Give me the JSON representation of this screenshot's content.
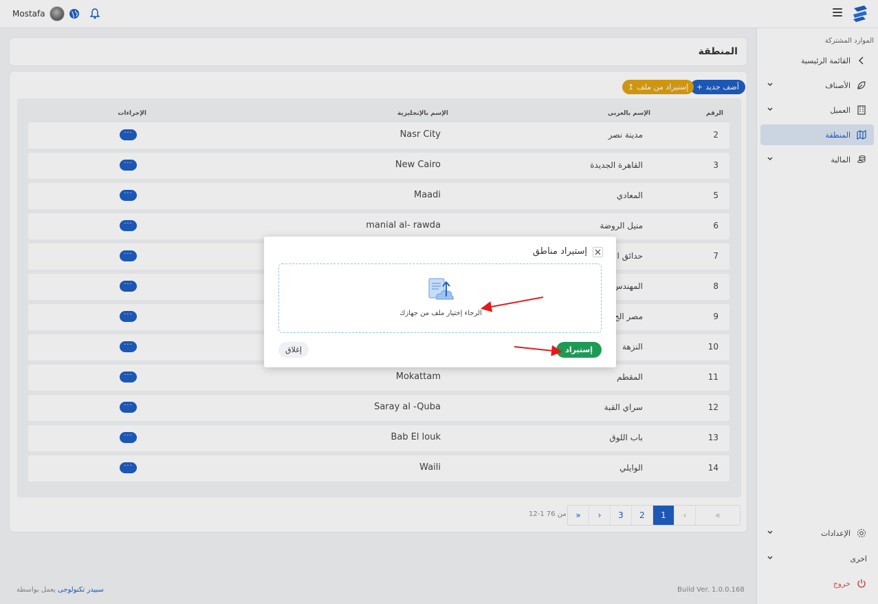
{
  "topbar": {
    "user_name": "Mostafa"
  },
  "sidebar": {
    "section_title": "الموارد المشتركة",
    "items": [
      {
        "label": "القائمة الرئيسية"
      },
      {
        "label": "الأصناف"
      },
      {
        "label": "العميل"
      },
      {
        "label": "المنطقة"
      },
      {
        "label": "المالية"
      }
    ],
    "settings_label": "الإعدادات",
    "other_label": "اخرى",
    "logout_label": "خروج"
  },
  "page": {
    "title": "المنطقة",
    "add_button": "أضف جديد",
    "import_file_button": "إستيراد من ملف"
  },
  "table": {
    "headers": {
      "num": "الرقم",
      "name_ar": "الإسم بالعربى",
      "name_en": "الإسم بالإنجليزية",
      "actions": "الإجراءات"
    },
    "rows": [
      {
        "num": "2",
        "ar": "مدينة نصر",
        "en": "Nasr City"
      },
      {
        "num": "3",
        "ar": "القاهرة الجديدة",
        "en": "New Cairo"
      },
      {
        "num": "5",
        "ar": "المعادي",
        "en": "Maadi"
      },
      {
        "num": "6",
        "ar": "منيل الروضة",
        "en": "manial al- rawda"
      },
      {
        "num": "7",
        "ar": "حدائق ا",
        "en": ""
      },
      {
        "num": "8",
        "ar": "المهندس",
        "en": ""
      },
      {
        "num": "9",
        "ar": "مصر الج",
        "en": ""
      },
      {
        "num": "10",
        "ar": "النزهة",
        "en": ""
      },
      {
        "num": "11",
        "ar": "المقطم",
        "en": "Mokattam"
      },
      {
        "num": "12",
        "ar": "سراي القبة",
        "en": "Saray al -Quba"
      },
      {
        "num": "13",
        "ar": "باب اللوق",
        "en": "Bab El louk"
      },
      {
        "num": "14",
        "ar": "الوايلي",
        "en": "Waili"
      }
    ],
    "action_label": "···"
  },
  "pagination": {
    "first": "«",
    "prev": "‹",
    "pages": [
      "1",
      "2",
      "3"
    ],
    "next": "›",
    "last": "»",
    "info": "12-1 من 76"
  },
  "footer": {
    "powered_prefix": "يعمل بواسطة",
    "powered_link": "سبيدر تكنولوجى",
    "build": "Build Ver. 1.0.0.168"
  },
  "modal": {
    "title": "إستيراد مناطق",
    "dropzone_text": "الرجاء إختيار ملف من جهازك",
    "import_button": "إستيراد",
    "close_button": "إغلاق"
  },
  "colors": {
    "primary": "#1f5fc4",
    "warning": "#e0a312",
    "success": "#1d9a56",
    "danger": "#d9534f",
    "annotation_arrow": "#e21b1b"
  }
}
